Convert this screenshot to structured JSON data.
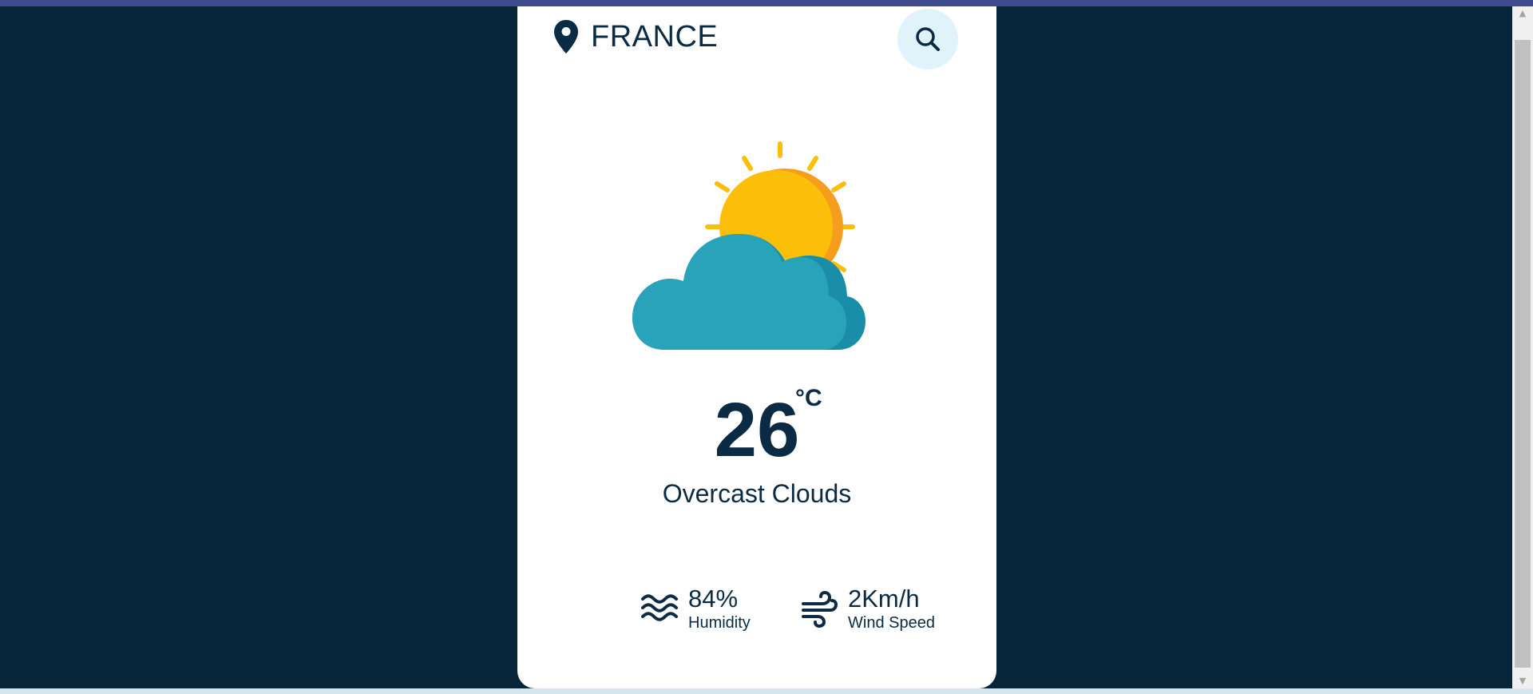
{
  "location": {
    "name": "FRANCE",
    "icon": "map-pin-icon"
  },
  "search": {
    "icon": "search-icon"
  },
  "weather": {
    "icon": "partly-cloudy-icon",
    "temperature": "26",
    "unit": "°C",
    "description": "Overcast Clouds"
  },
  "details": {
    "humidity": {
      "value": "84%",
      "label": "Humidity",
      "icon": "humidity-waves-icon"
    },
    "wind": {
      "value": "2Km/h",
      "label": "Wind Speed",
      "icon": "wind-icon"
    }
  },
  "colors": {
    "page_background": "#062539",
    "card_background": "#ffffff",
    "text": "#0b2a44",
    "search_button_background": "#e0f3fb",
    "sun": "#fbbf0a",
    "sun_shade": "#f79d1e",
    "cloud": "#29a3b9",
    "cloud_shade": "#1a8ea8"
  }
}
